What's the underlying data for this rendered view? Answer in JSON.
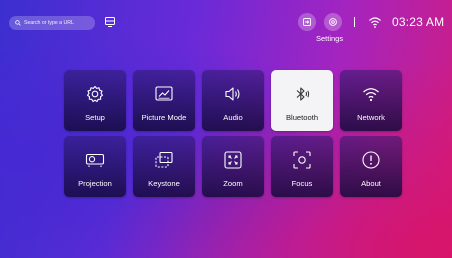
{
  "topbar": {
    "search_placeholder": "Search or type a URL",
    "settings_label": "Settings",
    "time": "03:23 AM"
  },
  "tiles": [
    {
      "label": "Setup",
      "icon": "gear-icon"
    },
    {
      "label": "Picture Mode",
      "icon": "picture-mode-icon"
    },
    {
      "label": "Audio",
      "icon": "speaker-icon"
    },
    {
      "label": "Bluetooth",
      "icon": "bluetooth-icon",
      "selected": true
    },
    {
      "label": "Network",
      "icon": "wifi-icon"
    },
    {
      "label": "Projection",
      "icon": "projector-icon"
    },
    {
      "label": "Keystone",
      "icon": "keystone-icon"
    },
    {
      "label": "Zoom",
      "icon": "zoom-icon"
    },
    {
      "label": "Focus",
      "icon": "focus-icon"
    },
    {
      "label": "About",
      "icon": "info-icon"
    }
  ]
}
